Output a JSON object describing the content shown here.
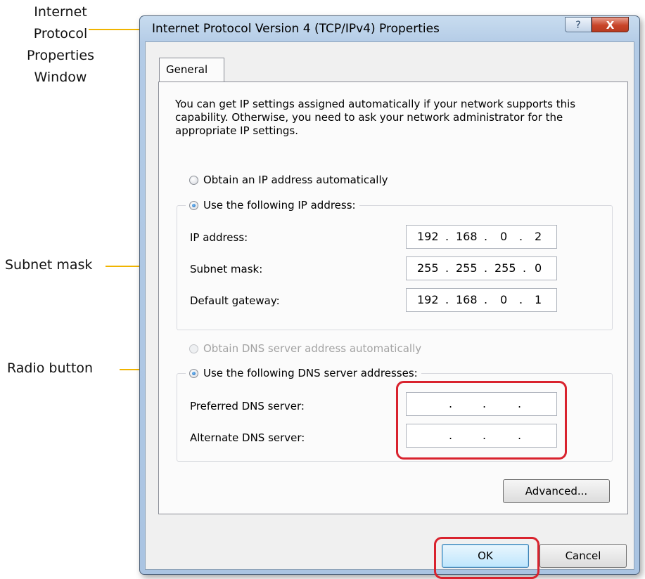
{
  "annotations": {
    "window_label": "Internet\nProtocol\nProperties\nWindow",
    "subnet_label": "Subnet mask",
    "radio_label": "Radio button",
    "line_color": "#f0b400",
    "highlight_color": "#d9232e"
  },
  "dialog": {
    "title": "Internet Protocol Version 4 (TCP/IPv4) Properties",
    "help_glyph": "?",
    "close_glyph": "X",
    "tab_label": "General",
    "description": "You can get IP settings assigned automatically if your network supports this capability. Otherwise, you need to ask your network administrator for the appropriate IP settings.",
    "ip_options": {
      "auto_label": "Obtain an IP address automatically",
      "manual_label": "Use the following IP address:",
      "selected": "manual"
    },
    "ip_fields": {
      "ip_label": "IP address:",
      "ip_octets": [
        "192",
        "168",
        "0",
        "2"
      ],
      "subnet_label": "Subnet mask:",
      "subnet_octets": [
        "255",
        "255",
        "255",
        "0"
      ],
      "gateway_label": "Default gateway:",
      "gateway_octets": [
        "192",
        "168",
        "0",
        "1"
      ]
    },
    "dns_options": {
      "auto_label": "Obtain DNS server address automatically",
      "manual_label": "Use the following DNS server addresses:",
      "selected": "manual",
      "auto_disabled": true
    },
    "dns_fields": {
      "preferred_label": "Preferred DNS server:",
      "alternate_label": "Alternate DNS server:",
      "dot": "."
    },
    "advanced_label": "Advanced...",
    "ok_label": "OK",
    "cancel_label": "Cancel"
  }
}
